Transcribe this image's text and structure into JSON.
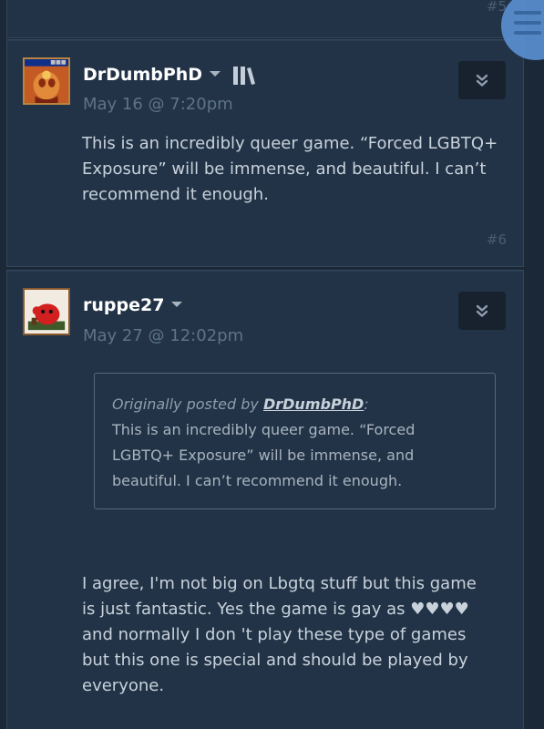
{
  "thread": {
    "previous_post_number": "#5"
  },
  "posts": [
    {
      "username": "DrDumbPhD",
      "timestamp": "May 16 @ 7:20pm",
      "body": "This is an incredibly queer game. “Forced LGBTQ+\nExposure” will be immense, and beautiful. I can’t\nrecommend it enough.",
      "post_number": "#6",
      "avatar_icon": "window-avatar-icon",
      "badge_icon": "library-icon"
    },
    {
      "username": "ruppe27",
      "timestamp": "May 27 @ 12:02pm",
      "avatar_icon": "red-creature-avatar-icon",
      "quote": {
        "prefix": "Originally posted by ",
        "author": "DrDumbPhD",
        "suffix": ":",
        "text": "This is an incredibly queer game. “Forced\nLGBTQ+ Exposure” will be immense, and\nbeautiful. I can’t recommend it enough."
      },
      "body": "I agree, I'm not big on Lbgtq stuff but this game\nis just fantastic. Yes the game is gay as ♥♥♥♥\nand normally I don 't play these type of games\nbut this one is special and should be played by\neveryone."
    }
  ],
  "colors": {
    "background": "#1b2838",
    "card": "#223347",
    "username": "#ffffff",
    "timestamp": "#5e7386",
    "body_text": "#c9d2db",
    "fab": "#5a8fd0"
  }
}
